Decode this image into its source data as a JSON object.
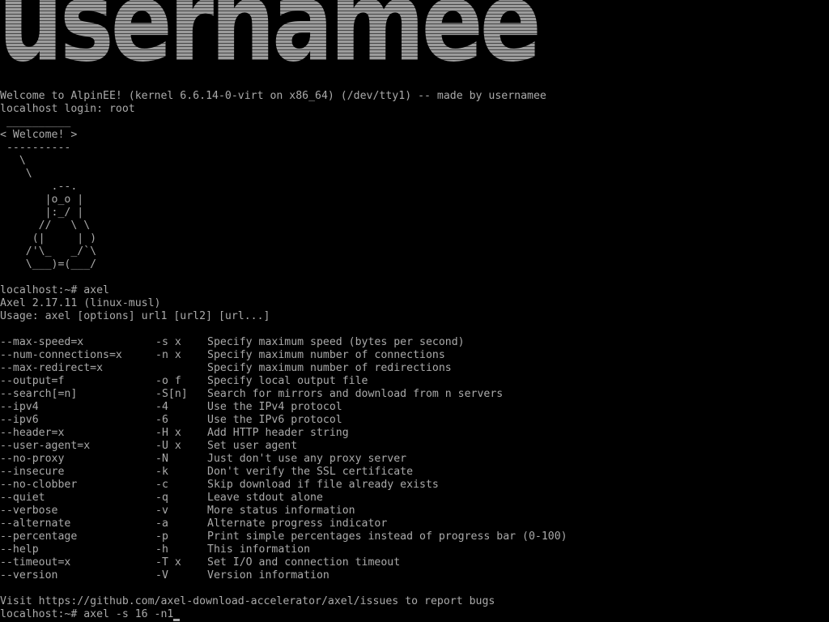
{
  "banner": {
    "text": "usernamee"
  },
  "welcome_line": "Welcome to AlpinEE! (kernel 6.6.14-0-virt on x86_64) (/dev/tty1) -- made by usernamee",
  "login_line": "localhost login: root",
  "cowsay_art": [
    " __________",
    "< Welcome! >",
    " ----------",
    "   \\",
    "    \\",
    "        .--.",
    "       |o_o |",
    "       |:_/ |",
    "      //   \\ \\",
    "     (|     | )",
    "    /'\\_   _/`\\",
    "    \\___)=(___/"
  ],
  "prompt1": "localhost:~# axel",
  "version_line": "Axel 2.17.11 (linux-musl)",
  "usage_line": "Usage: axel [options] url1 [url2] [url...]",
  "options": [
    {
      "long": "--max-speed=x",
      "short": "-s x",
      "desc": "Specify maximum speed (bytes per second)"
    },
    {
      "long": "--num-connections=x",
      "short": "-n x",
      "desc": "Specify maximum number of connections"
    },
    {
      "long": "--max-redirect=x",
      "short": "",
      "desc": "Specify maximum number of redirections"
    },
    {
      "long": "--output=f",
      "short": "-o f",
      "desc": "Specify local output file"
    },
    {
      "long": "--search[=n]",
      "short": "-S[n]",
      "desc": "Search for mirrors and download from n servers"
    },
    {
      "long": "--ipv4",
      "short": "-4",
      "desc": "Use the IPv4 protocol"
    },
    {
      "long": "--ipv6",
      "short": "-6",
      "desc": "Use the IPv6 protocol"
    },
    {
      "long": "--header=x",
      "short": "-H x",
      "desc": "Add HTTP header string"
    },
    {
      "long": "--user-agent=x",
      "short": "-U x",
      "desc": "Set user agent"
    },
    {
      "long": "--no-proxy",
      "short": "-N",
      "desc": "Just don't use any proxy server"
    },
    {
      "long": "--insecure",
      "short": "-k",
      "desc": "Don't verify the SSL certificate"
    },
    {
      "long": "--no-clobber",
      "short": "-c",
      "desc": "Skip download if file already exists"
    },
    {
      "long": "--quiet",
      "short": "-q",
      "desc": "Leave stdout alone"
    },
    {
      "long": "--verbose",
      "short": "-v",
      "desc": "More status information"
    },
    {
      "long": "--alternate",
      "short": "-a",
      "desc": "Alternate progress indicator"
    },
    {
      "long": "--percentage",
      "short": "-p",
      "desc": "Print simple percentages instead of progress bar (0-100)"
    },
    {
      "long": "--help",
      "short": "-h",
      "desc": "This information"
    },
    {
      "long": "--timeout=x",
      "short": "-T x",
      "desc": "Set I/O and connection timeout"
    },
    {
      "long": "--version",
      "short": "-V",
      "desc": "Version information"
    }
  ],
  "visit_line": "Visit https://github.com/axel-download-accelerator/axel/issues to report bugs",
  "prompt2": "localhost:~# axel -s 16 -n1",
  "colors": {
    "background": "#000000",
    "text": "#aaaaaa",
    "banner": "#9c9c9c"
  }
}
